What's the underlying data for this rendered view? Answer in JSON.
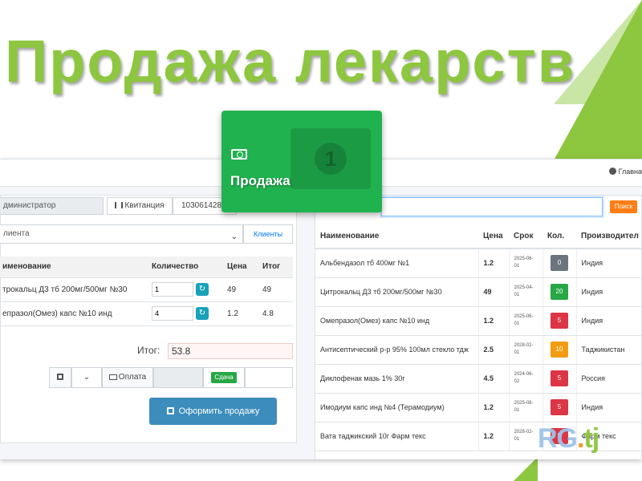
{
  "headline": "Продажа лекарств",
  "topbar": {
    "home_label": "Главна"
  },
  "sale_card": {
    "label": "Продажа"
  },
  "left_panel": {
    "admin_value": "дминистратор",
    "receipt_label": "Квитанция",
    "receipt_number": "103061428",
    "client_select": "лиента",
    "clients_button": "Клиенты",
    "columns": [
      "именование",
      "Количество",
      "Цена",
      "Итог"
    ],
    "rows": [
      {
        "name": "трокальц Д3 тб 200мг/500мг №30",
        "qty": "1",
        "price": "49",
        "total": "49"
      },
      {
        "name": "епразол(Омез) капс №10 инд",
        "qty": "4",
        "price": "1.2",
        "total": "4.8"
      }
    ],
    "total_label": "Итог:",
    "total_value": "53.8",
    "pay_label": "Оплата",
    "change_label": "Сдача",
    "checkout_label": "Оформить продажу"
  },
  "right_panel": {
    "search_button": "Поиск",
    "columns": [
      "Наименование",
      "Цена",
      "Срок",
      "Кол.",
      "Производител"
    ],
    "rows": [
      {
        "name": "Альбендазол тб 400мг №1",
        "price": "1.2",
        "date": "2025-06-01",
        "qty": "0",
        "qty_color": "#6c757d",
        "maker": "Индия"
      },
      {
        "name": "Цитрокальц Д3 тб 200мг/500мг №30",
        "price": "49",
        "date": "2025-04-01",
        "qty": "20",
        "qty_color": "#28a745",
        "maker": "Индия"
      },
      {
        "name": "Омепразол(Омез) капс №10 инд",
        "price": "1.2",
        "date": "2025-06-01",
        "qty": "5",
        "qty_color": "#dc3545",
        "maker": "Индия"
      },
      {
        "name": "Антисептический р-р 95% 100мл стекло тдж",
        "price": "2.5",
        "date": "2028-02-01",
        "qty": "10",
        "qty_color": "#f39c12",
        "maker": "Таджикистан"
      },
      {
        "name": "Диклофенак мазь 1% 30г",
        "price": "4.5",
        "date": "2024-06-02",
        "qty": "5",
        "qty_color": "#dc3545",
        "maker": "Россия"
      },
      {
        "name": "Имодиум капс инд №4 (Терамодиум)",
        "price": "1.2",
        "date": "2025-08-01",
        "qty": "5",
        "qty_color": "#dc3545",
        "maker": "Индия"
      },
      {
        "name": "Вата таджикский 10г Фарм текс",
        "price": "1.2",
        "date": "2028-02-01",
        "qty": "5",
        "qty_color": "#dc3545",
        "maker": "Фарм текс"
      }
    ]
  },
  "logo": {
    "rg": "RG",
    "dot": ".",
    "tj": "tj"
  },
  "colors": {
    "brand_green": "#8dc63f",
    "sale_green": "#21b250",
    "primary_blue": "#3c8dbc",
    "search_orange": "#fd7e14"
  }
}
